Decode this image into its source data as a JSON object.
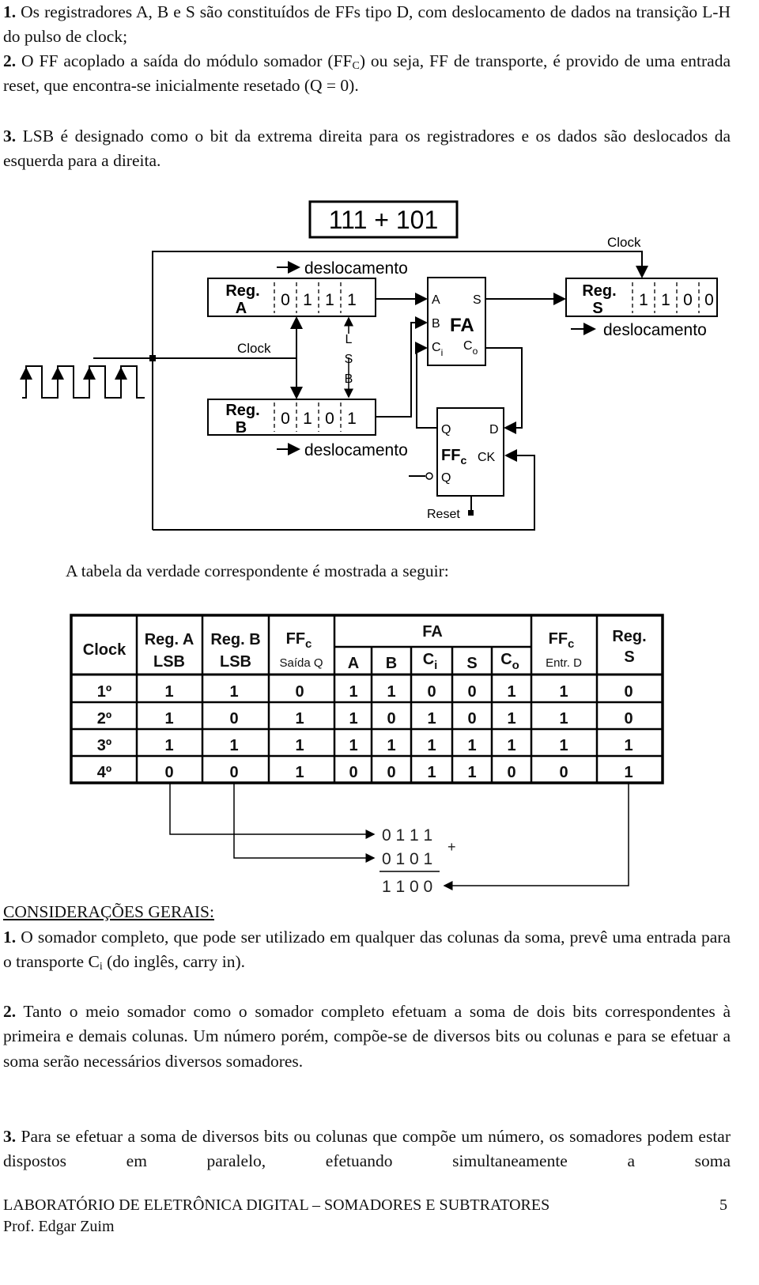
{
  "intro": [
    {
      "num": "1.",
      "text": "Os registradores A, B e S são constituídos de FFs tipo D, com deslocamento de dados na transição L-H do pulso de clock;"
    },
    {
      "num": "2.",
      "text_a": "O FF acoplado a saída do módulo somador (FF",
      "sub": "C",
      "text_b": ") ou seja, FF de transporte, é provido de uma entrada reset, que encontra-se inicialmente resetado (Q = 0)."
    },
    {
      "num": "3.",
      "text": "LSB é designado como o bit da extrema direita para os registradores e os dados são deslocados da esquerda para a direita."
    }
  ],
  "diagram": {
    "title": "111 + 101",
    "clock": "Clock",
    "shift": "deslocamento",
    "reg": "Reg.",
    "reg_a": {
      "name": "A",
      "bits": [
        "0",
        "1",
        "1",
        "1"
      ]
    },
    "reg_b": {
      "name": "B",
      "bits": [
        "0",
        "1",
        "0",
        "1"
      ]
    },
    "reg_s": {
      "name": "S",
      "bits": [
        "1",
        "1",
        "0",
        "0"
      ]
    },
    "lsb": [
      "L",
      "S",
      "B"
    ],
    "fa": {
      "label": "FA",
      "a": "A",
      "b": "B",
      "ci": "C",
      "ci_sub": "i",
      "s": "S",
      "co": "C",
      "co_sub": "o"
    },
    "ff": {
      "label": "FF",
      "sub": "c",
      "q": "Q",
      "d": "D",
      "ck": "CK",
      "qn": "Q"
    },
    "reset": "Reset"
  },
  "caption": "A tabela da verdade correspondente é mostrada a seguir:",
  "table": {
    "headers": {
      "clock": "Clock",
      "reg_a": [
        "Reg. A",
        "LSB"
      ],
      "reg_b": [
        "Reg. B",
        "LSB"
      ],
      "ffc_q": [
        "FF",
        "c",
        "Saída Q"
      ],
      "fa": "FA",
      "fa_cols": [
        "A",
        "B",
        "C",
        "S",
        "C"
      ],
      "fa_subs": [
        "",
        "",
        "i",
        "",
        "o"
      ],
      "ffc_d": [
        "FF",
        "c",
        "Entr. D"
      ],
      "reg_s": [
        "Reg.",
        "S"
      ]
    },
    "rows": [
      [
        "1º",
        "1",
        "1",
        "0",
        "1",
        "1",
        "0",
        "0",
        "1",
        "1",
        "0"
      ],
      [
        "2º",
        "1",
        "0",
        "1",
        "1",
        "0",
        "1",
        "0",
        "1",
        "1",
        "0"
      ],
      [
        "3º",
        "1",
        "1",
        "1",
        "1",
        "1",
        "1",
        "1",
        "1",
        "1",
        "1"
      ],
      [
        "4º",
        "0",
        "0",
        "1",
        "0",
        "0",
        "1",
        "1",
        "0",
        "0",
        "1"
      ]
    ]
  },
  "sum": {
    "a": "0 1 1 1",
    "b": "0 1 0 1",
    "plus": "+",
    "result": "1 1 0 0"
  },
  "considerations": {
    "title": "CONSIDERAÇÕES GERAIS:",
    "items": [
      {
        "num": "1.",
        "text_a": "O somador completo, que pode ser utilizado em qualquer das colunas da soma, prevê uma entrada para o transporte C",
        "sub": "i",
        "text_b": " (do inglês, carry in)."
      },
      {
        "num": "2.",
        "text": "Tanto o meio somador como o somador completo efetuam a soma de dois bits correspondentes à primeira e demais colunas. Um número porém, compõe-se de diversos bits ou colunas e para se efetuar a soma serão necessários diversos somadores."
      },
      {
        "num": "3.",
        "text": "Para se efetuar a soma de diversos bits ou colunas que compõe um número, os somadores podem estar dispostos em paralelo, efetuando simultaneamente a soma"
      }
    ]
  },
  "footer": {
    "title": "LABORATÓRIO DE ELETRÔNICA DIGITAL – SOMADORES E SUBTRATORES",
    "page": "5",
    "author": "Prof. Edgar Zuim"
  }
}
